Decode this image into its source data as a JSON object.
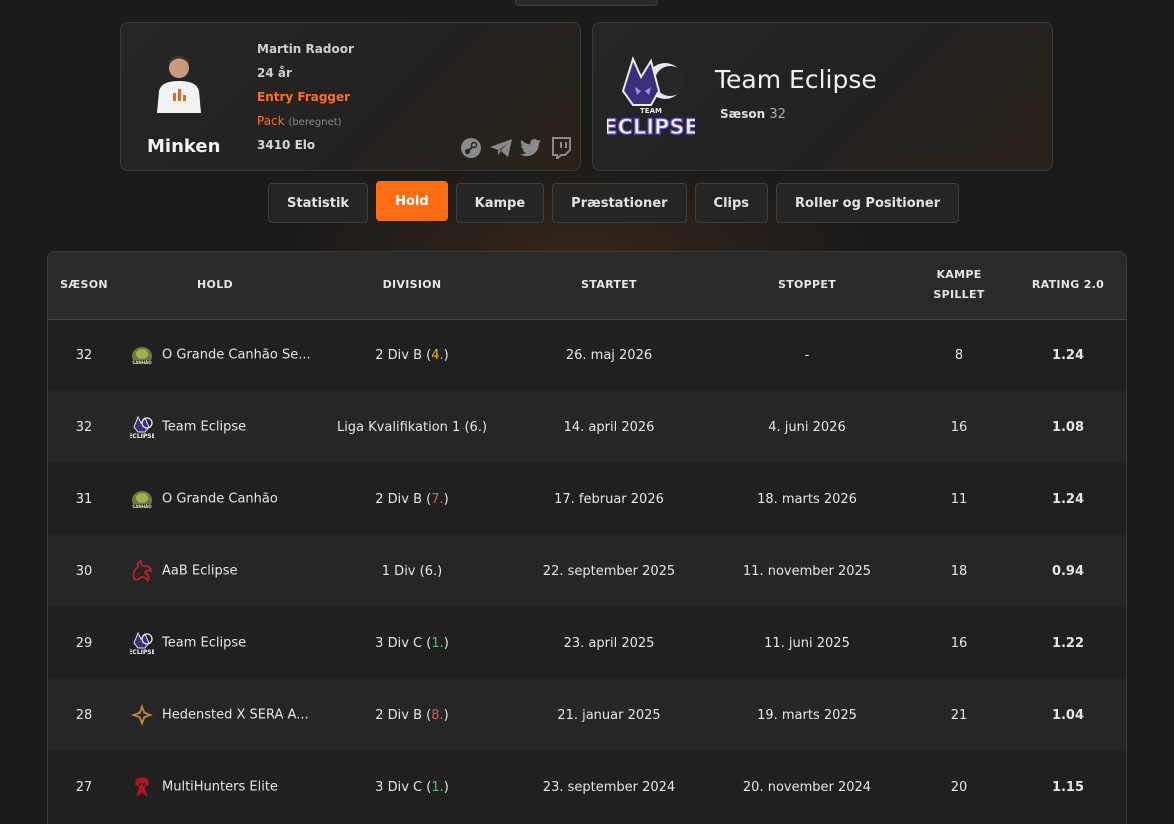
{
  "player": {
    "nickname": "Minken",
    "name": "Martin Radoor",
    "age": "24 år",
    "role": "Entry Fragger",
    "pack": "Pack",
    "pack_note": "(beregnet)",
    "elo": "3410 Elo",
    "socials": [
      "steam-icon",
      "telegram-icon",
      "twitter-icon",
      "twitch-icon"
    ]
  },
  "team": {
    "name": "Team Eclipse",
    "season_label": "Sæson",
    "season_value": "32"
  },
  "tabs": [
    {
      "label": "Statistik",
      "active": false
    },
    {
      "label": "Hold",
      "active": true
    },
    {
      "label": "Kampe",
      "active": false
    },
    {
      "label": "Præstationer",
      "active": false
    },
    {
      "label": "Clips",
      "active": false
    },
    {
      "label": "Roller og Positioner",
      "active": false
    }
  ],
  "table": {
    "headers": {
      "season": "SÆSON",
      "team": "HOLD",
      "division": "DIVISION",
      "started": "STARTET",
      "stopped": "STOPPET",
      "matches_1": "KAMPE",
      "matches_2": "SPILLET",
      "rating": "RATING 2.0"
    },
    "rows": [
      {
        "season": "32",
        "team": "O Grande Canhão Se...",
        "logo": "canhao-logo",
        "division": "2 Div B",
        "pos": "4.",
        "pos_color": "#f0b429",
        "started": "26. maj 2026",
        "stopped": "-",
        "matches": "8",
        "rating": "1.24"
      },
      {
        "season": "32",
        "team": "Team Eclipse",
        "logo": "eclipse-logo",
        "division": "Liga Kvalifikation 1",
        "pos": "6.",
        "pos_color": "#e6e6e6",
        "started": "14. april 2026",
        "stopped": "4. juni 2026",
        "matches": "16",
        "rating": "1.08"
      },
      {
        "season": "31",
        "team": "O Grande Canhão",
        "logo": "canhao-logo",
        "division": "2 Div B",
        "pos": "7.",
        "pos_color": "#e0584e",
        "started": "17. februar 2026",
        "stopped": "18. marts 2026",
        "matches": "11",
        "rating": "1.24"
      },
      {
        "season": "30",
        "team": "AaB Eclipse",
        "logo": "aab-logo",
        "division": "1 Div",
        "pos": "6.",
        "pos_color": "#e6e6e6",
        "started": "22. september 2025",
        "stopped": "11. november 2025",
        "matches": "18",
        "rating": "0.94"
      },
      {
        "season": "29",
        "team": "Team Eclipse",
        "logo": "eclipse-logo",
        "division": "3 Div C",
        "pos": "1.",
        "pos_color": "#3fc76b",
        "started": "23. april 2025",
        "stopped": "11. juni 2025",
        "matches": "16",
        "rating": "1.22"
      },
      {
        "season": "28",
        "team": "Hedensted X SERA A...",
        "logo": "hedensted-logo",
        "division": "2 Div B",
        "pos": "8.",
        "pos_color": "#e0584e",
        "started": "21. januar 2025",
        "stopped": "19. marts 2025",
        "matches": "21",
        "rating": "1.04"
      },
      {
        "season": "27",
        "team": "MultiHunters Elite",
        "logo": "multihunters-logo",
        "division": "3 Div C",
        "pos": "1.",
        "pos_color": "#3fc76b",
        "started": "23. september 2024",
        "stopped": "20. november 2024",
        "matches": "20",
        "rating": "1.15"
      }
    ]
  }
}
